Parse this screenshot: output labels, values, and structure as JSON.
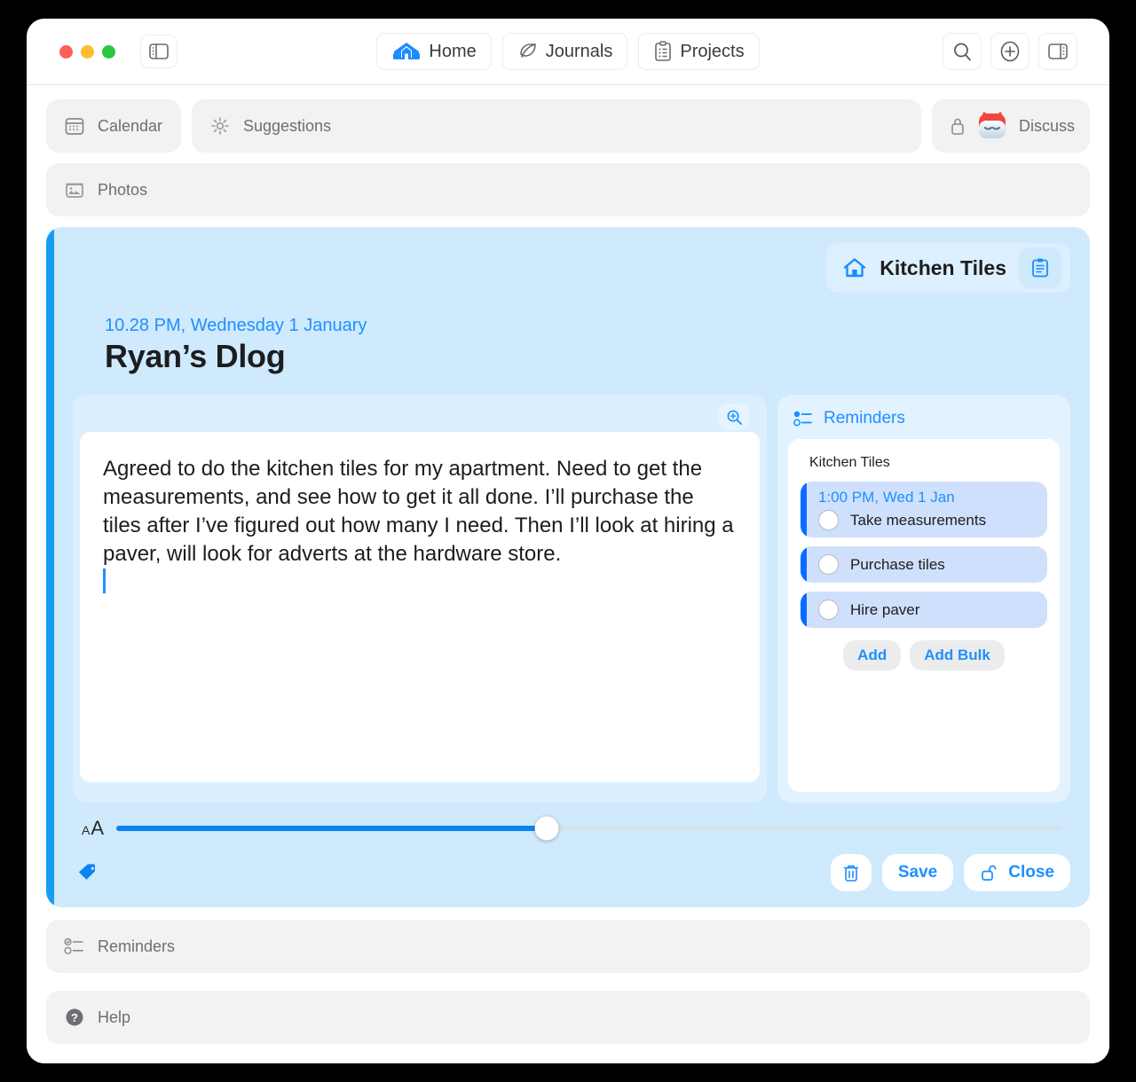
{
  "titlebar": {
    "sidebar_left_icon": "sidebar-left-toggle-icon",
    "tabs": [
      {
        "label": "Home",
        "icon": "home-icon",
        "active": true
      },
      {
        "label": "Journals",
        "icon": "leaf-icon",
        "active": false
      },
      {
        "label": "Projects",
        "icon": "clipboard-list-icon",
        "active": false
      }
    ],
    "right_actions": [
      {
        "name": "search-button",
        "icon": "search-icon"
      },
      {
        "name": "add-button",
        "icon": "plus-circle-icon"
      },
      {
        "name": "inspector-toggle-button",
        "icon": "sidebar-right-toggle-icon"
      }
    ]
  },
  "toolbar": {
    "calendar_label": "Calendar",
    "suggestions_placeholder": "Suggestions",
    "discuss_label": "Discuss",
    "photos_label": "Photos"
  },
  "note": {
    "chip_title": "Kitchen Tiles",
    "timestamp": "10.28 PM, Wednesday 1 January",
    "title": "Ryan’s Dlog",
    "body": "Agreed to do the kitchen tiles for my apartment. Need to get the measurements, and see how to get it all done. I’ll purchase the tiles after I’ve figured out how many I need. Then I’ll look at hiring a paver, will look for adverts at the hardware store.",
    "font_size_slider_percent": 45.5,
    "font_size_small": "A",
    "font_size_large": "A"
  },
  "reminders_panel": {
    "header": "Reminders",
    "group": "Kitchen Tiles",
    "items": [
      {
        "when": "1:00 PM, Wed 1 Jan",
        "text": "Take measurements",
        "checked": false
      },
      {
        "when": "",
        "text": "Purchase tiles",
        "checked": false
      },
      {
        "when": "",
        "text": "Hire paver",
        "checked": false
      }
    ],
    "add_label": "Add",
    "add_bulk_label": "Add Bulk"
  },
  "footer_actions": {
    "delete_icon": "trash-icon",
    "save_label": "Save",
    "close_label": "Close",
    "lock_icon": "unlocked-padlock-icon",
    "tag_icon": "tag-icon"
  },
  "bottom_sections": {
    "reminders_label": "Reminders",
    "help_label": "Help"
  },
  "colors": {
    "accent_blue": "#1e90ff",
    "card_blue": "#cfe9fd",
    "bar_blue": "#0a6bff",
    "traffic_red": "#ff5f57",
    "traffic_amber": "#febc2e",
    "traffic_green": "#28c840"
  }
}
